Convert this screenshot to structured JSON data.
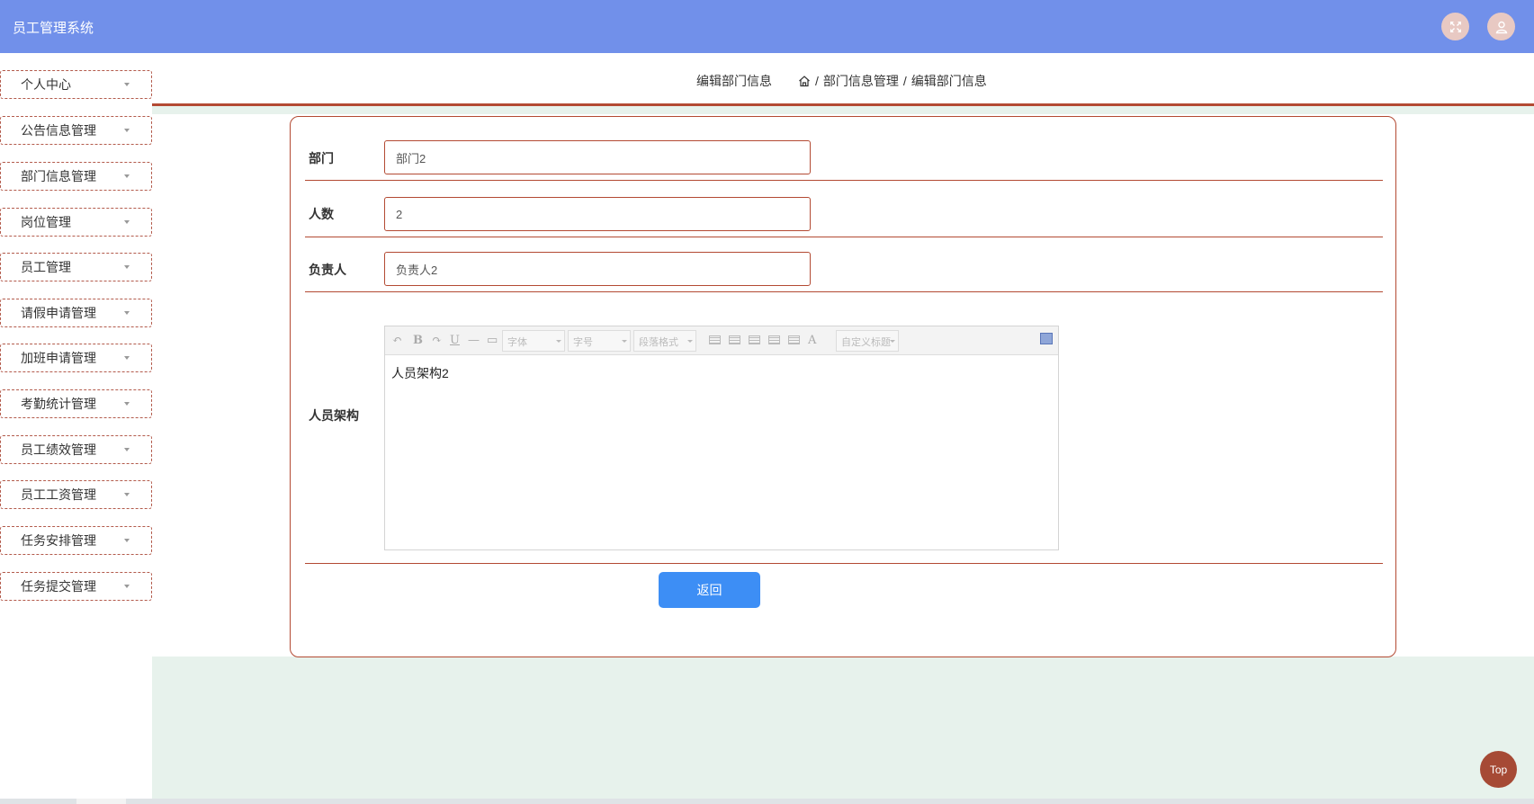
{
  "app": {
    "title": "员工管理系统"
  },
  "header": {
    "fullscreen_icon": "fullscreen-icon",
    "user_icon": "user-icon"
  },
  "sidebar": {
    "items": [
      {
        "label": "个人中心"
      },
      {
        "label": "公告信息管理"
      },
      {
        "label": "部门信息管理"
      },
      {
        "label": "岗位管理"
      },
      {
        "label": "员工管理"
      },
      {
        "label": "请假申请管理"
      },
      {
        "label": "加班申请管理"
      },
      {
        "label": "考勤统计管理"
      },
      {
        "label": "员工绩效管理"
      },
      {
        "label": "员工工资管理"
      },
      {
        "label": "任务安排管理"
      },
      {
        "label": "任务提交管理"
      }
    ]
  },
  "page": {
    "title": "编辑部门信息",
    "breadcrumb": {
      "sep": "/",
      "parent": "部门信息管理",
      "current": "编辑部门信息"
    }
  },
  "form": {
    "department": {
      "label": "部门",
      "value": "部门2"
    },
    "headcount": {
      "label": "人数",
      "value": "2"
    },
    "manager": {
      "label": "负责人",
      "value": "负责人2"
    },
    "structure": {
      "label": "人员架构",
      "value": "人员架构2"
    }
  },
  "editor_toolbar": {
    "font": "字体",
    "size": "字号",
    "paragraph": "段落格式",
    "custom": "自定义标题",
    "bold": "B",
    "underline": "U",
    "font_color": "A"
  },
  "buttons": {
    "back": "返回",
    "top": "Top"
  },
  "colors": {
    "header": "#7190ea",
    "accent": "#b34a33",
    "primary": "#3d8ef5",
    "background": "#e7f2ec"
  }
}
